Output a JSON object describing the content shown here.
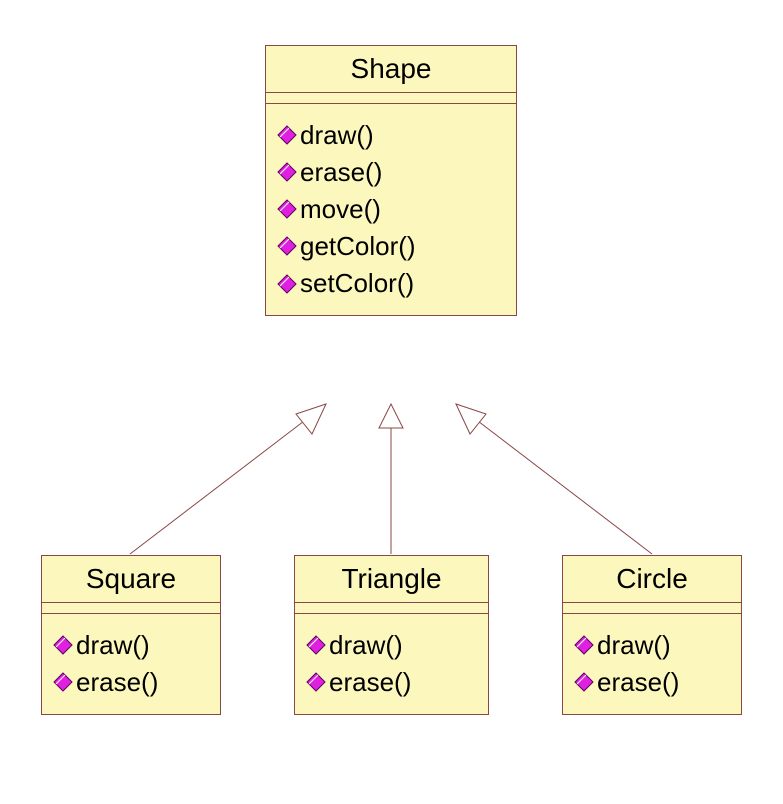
{
  "classes": {
    "shape": {
      "name": "Shape",
      "methods": [
        "draw()",
        "erase()",
        "move()",
        "getColor()",
        "setColor()"
      ]
    },
    "square": {
      "name": "Square",
      "methods": [
        "draw()",
        "erase()"
      ]
    },
    "triangle": {
      "name": "Triangle",
      "methods": [
        "draw()",
        "erase()"
      ]
    },
    "circle": {
      "name": "Circle",
      "methods": [
        "draw()",
        "erase()"
      ]
    }
  },
  "relations": [
    {
      "child": "square",
      "parent": "shape",
      "type": "inheritance"
    },
    {
      "child": "triangle",
      "parent": "shape",
      "type": "inheritance"
    },
    {
      "child": "circle",
      "parent": "shape",
      "type": "inheritance"
    }
  ]
}
